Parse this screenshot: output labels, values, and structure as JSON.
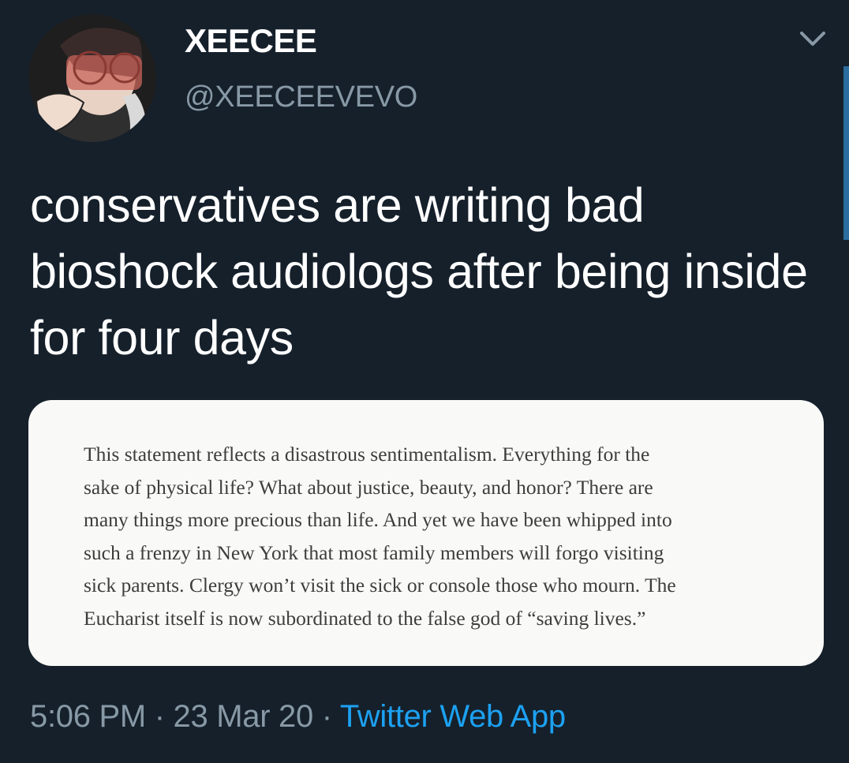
{
  "user": {
    "display_name": "XEECEE",
    "handle": "@XEECEEVEVO"
  },
  "tweet": {
    "text": "conservatives are writing bad bioshock audiologs after being inside for four days"
  },
  "media": {
    "quote_lines": [
      "This statement reflects a disastrous sentimentalism. Everything for the",
      "sake of physical life? What about justice, beauty, and honor? There are",
      "many things more precious than life. And yet we have been whipped into",
      "such a frenzy in New York that most family members will forgo visiting",
      "sick parents. Clergy won’t visit the sick or console those who mourn. The",
      "Eucharist itself is now subordinated to the false god of “saving lives.”"
    ]
  },
  "meta": {
    "time": "5:06 PM",
    "separator": " · ",
    "date": "23 Mar 20",
    "source": "Twitter Web App"
  },
  "icons": {
    "menu": "chevron-down-icon"
  },
  "colors": {
    "background": "#15202b",
    "primary_text": "#ffffff",
    "secondary_text": "#8899a6",
    "link": "#1da1f2",
    "card_background": "#f9f9f7"
  }
}
